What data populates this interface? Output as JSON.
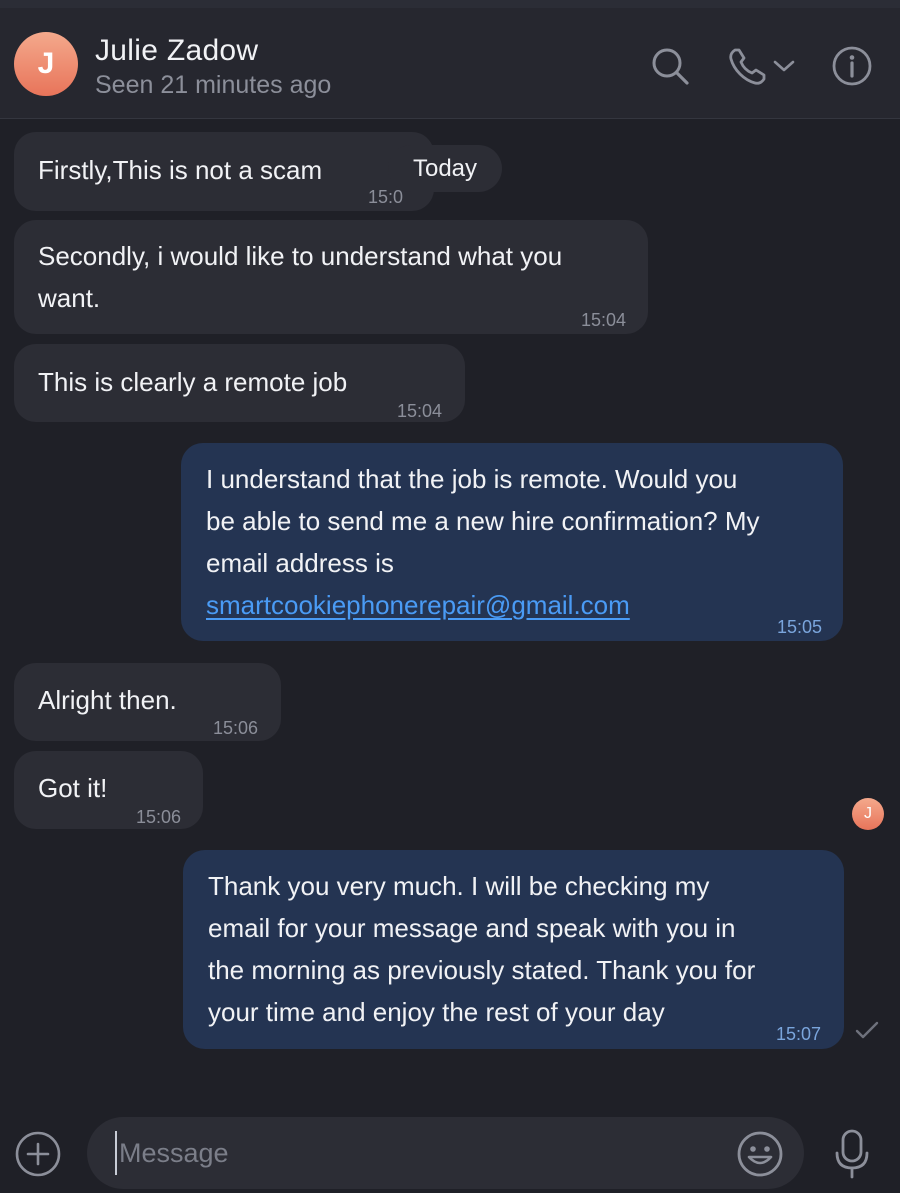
{
  "header": {
    "avatar_initial": "J",
    "name": "Julie Zadow",
    "status": "Seen 21 minutes ago",
    "icons": [
      "search-icon",
      "phone-icon",
      "chevron-down-icon",
      "info-icon"
    ]
  },
  "date_pill": "Today",
  "messages": [
    {
      "direction": "incoming",
      "text_lines": [
        "Firstly,This is not a scam"
      ],
      "time": "15:0"
    },
    {
      "direction": "incoming",
      "text_lines": [
        "Secondly, i would like to understand what you",
        "want."
      ],
      "time": "15:04"
    },
    {
      "direction": "incoming",
      "text_lines": [
        "This is clearly a remote job"
      ],
      "time": "15:04"
    },
    {
      "direction": "outgoing",
      "text_lines": [
        "I understand that the job is remote. Would you",
        "be able to send me a new hire confirmation? My",
        "email address is"
      ],
      "link": "smartcookiephonerepair@gmail.com",
      "time": "15:05"
    },
    {
      "direction": "incoming",
      "text_lines": [
        "Alright then."
      ],
      "time": "15:06"
    },
    {
      "direction": "incoming",
      "text_lines": [
        "Got it!"
      ],
      "time": "15:06"
    },
    {
      "direction": "outgoing",
      "text_lines": [
        "Thank you very much. I will be checking my",
        "email for your message and speak with you in",
        "the morning as previously stated. Thank you for",
        "your time and enjoy the rest of your day"
      ],
      "time": "15:07"
    }
  ],
  "read_avatar_initial": "J",
  "composer": {
    "placeholder": "Message",
    "icons": [
      "plus-circle-icon",
      "emoji-icon",
      "microphone-icon"
    ]
  },
  "colors": {
    "background": "#1f2027",
    "incoming_bubble": "#2c2d35",
    "outgoing_bubble": "#243452",
    "link": "#4a9bf5",
    "avatar": "#ee8a6d"
  }
}
